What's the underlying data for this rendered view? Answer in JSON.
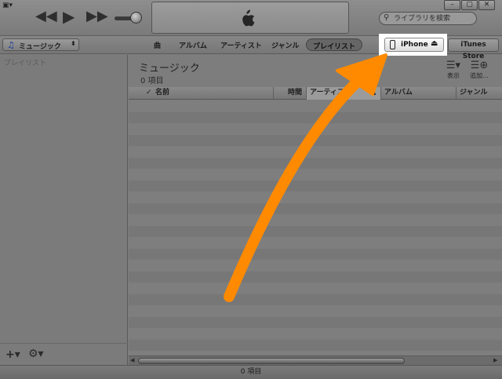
{
  "colors": {
    "arrow": "#FF8A00",
    "highlight": "#FFFFFF",
    "accent_note": "#1C3D9C"
  },
  "topbar": {
    "menu_icon": "menu-icon",
    "prev_icon": "previous-icon",
    "play_icon": "play-icon",
    "next_icon": "next-icon",
    "lcd_icon": "apple-logo-icon",
    "window": {
      "minimize": "–",
      "restore": "▢",
      "close": "✕"
    },
    "search": {
      "placeholder": "ライブラリを検索",
      "icon": "search-icon"
    }
  },
  "toolbar": {
    "library": {
      "label": "ミュージック",
      "icon": "music-note-icon"
    },
    "tabs": {
      "songs": "曲",
      "albums": "アルバム",
      "artists": "アーティスト",
      "genres": "ジャンル",
      "playlists": "プレイリスト"
    },
    "iphone": {
      "label": "iPhone",
      "icon": "iphone-icon",
      "eject_icon": "eject-icon"
    },
    "store": {
      "label": "iTunes Store"
    }
  },
  "sidebar": {
    "heading": "プレイリスト",
    "add_icon": "add-icon",
    "settings_icon": "gear-icon"
  },
  "main": {
    "title": "ミュージック",
    "count": "0 項目",
    "view_label": "表示",
    "add_label": "追加...",
    "columns": {
      "check": "✓",
      "name": "名前",
      "time": "時間",
      "artist": "アーティスト",
      "album": "アルバム",
      "genre": "ジャンル"
    }
  },
  "status": {
    "text": "0 項目"
  }
}
